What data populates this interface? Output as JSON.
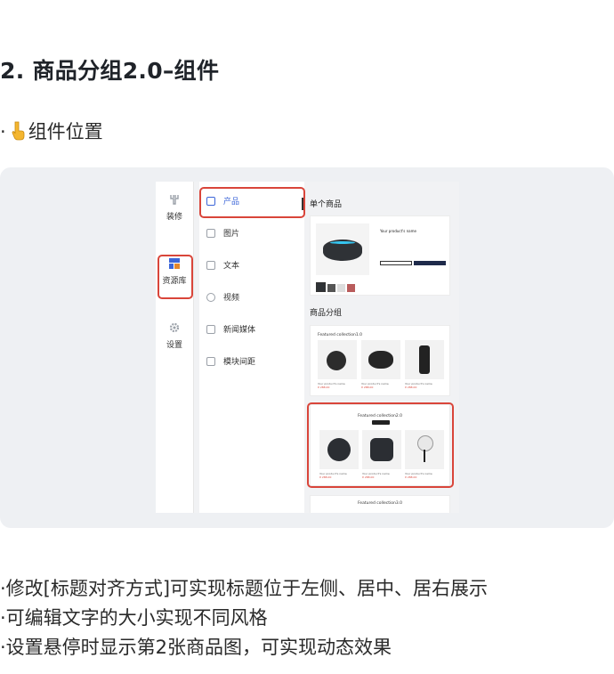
{
  "heading": "2. 商品分组2.0–组件",
  "intro": {
    "prefix": "·",
    "text": "组件位置"
  },
  "editor": {
    "rail": [
      {
        "label": "装修",
        "icon": "fork-icon"
      },
      {
        "label": "资源库",
        "icon": "grid-icon"
      },
      {
        "label": "设置",
        "icon": "gear-icon"
      }
    ],
    "components": [
      {
        "label": "产品",
        "icon": "product-icon"
      },
      {
        "label": "图片",
        "icon": "image-icon"
      },
      {
        "label": "文本",
        "icon": "text-icon"
      },
      {
        "label": "视频",
        "icon": "video-icon"
      },
      {
        "label": "新闻媒体",
        "icon": "news-icon"
      },
      {
        "label": "模块间距",
        "icon": "spacing-icon"
      }
    ],
    "preview": {
      "single_label": "单个商品",
      "product_name": "Your product's name",
      "group_label": "商品分组",
      "collections": [
        {
          "title": "Featured collection1.0",
          "items": [
            {
              "name": "Your product's name",
              "price": "¥ 288.00"
            },
            {
              "name": "Your product's name",
              "price": "¥ 288.00"
            },
            {
              "name": "Your product's name",
              "price": "¥ 288.00"
            }
          ]
        },
        {
          "title": "Featured collection2.0",
          "items": [
            {
              "name": "Your product's name",
              "price": "¥ 288.00"
            },
            {
              "name": "Your product's name",
              "price": "¥ 288.00"
            },
            {
              "name": "Your product's name",
              "price": "¥ 288.00"
            }
          ]
        },
        {
          "title": "Featured collection3.0",
          "items": []
        }
      ]
    }
  },
  "notes": [
    "·修改[标题对齐方式]可实现标题位于左侧、居中、居右展示",
    "·可编辑文字的大小实现不同风格",
    "·设置悬停时显示第2张商品图，可实现动态效果"
  ],
  "colors": {
    "highlight": "#d9453a",
    "accent": "#3c66d8",
    "panel": "#eef0f3"
  }
}
